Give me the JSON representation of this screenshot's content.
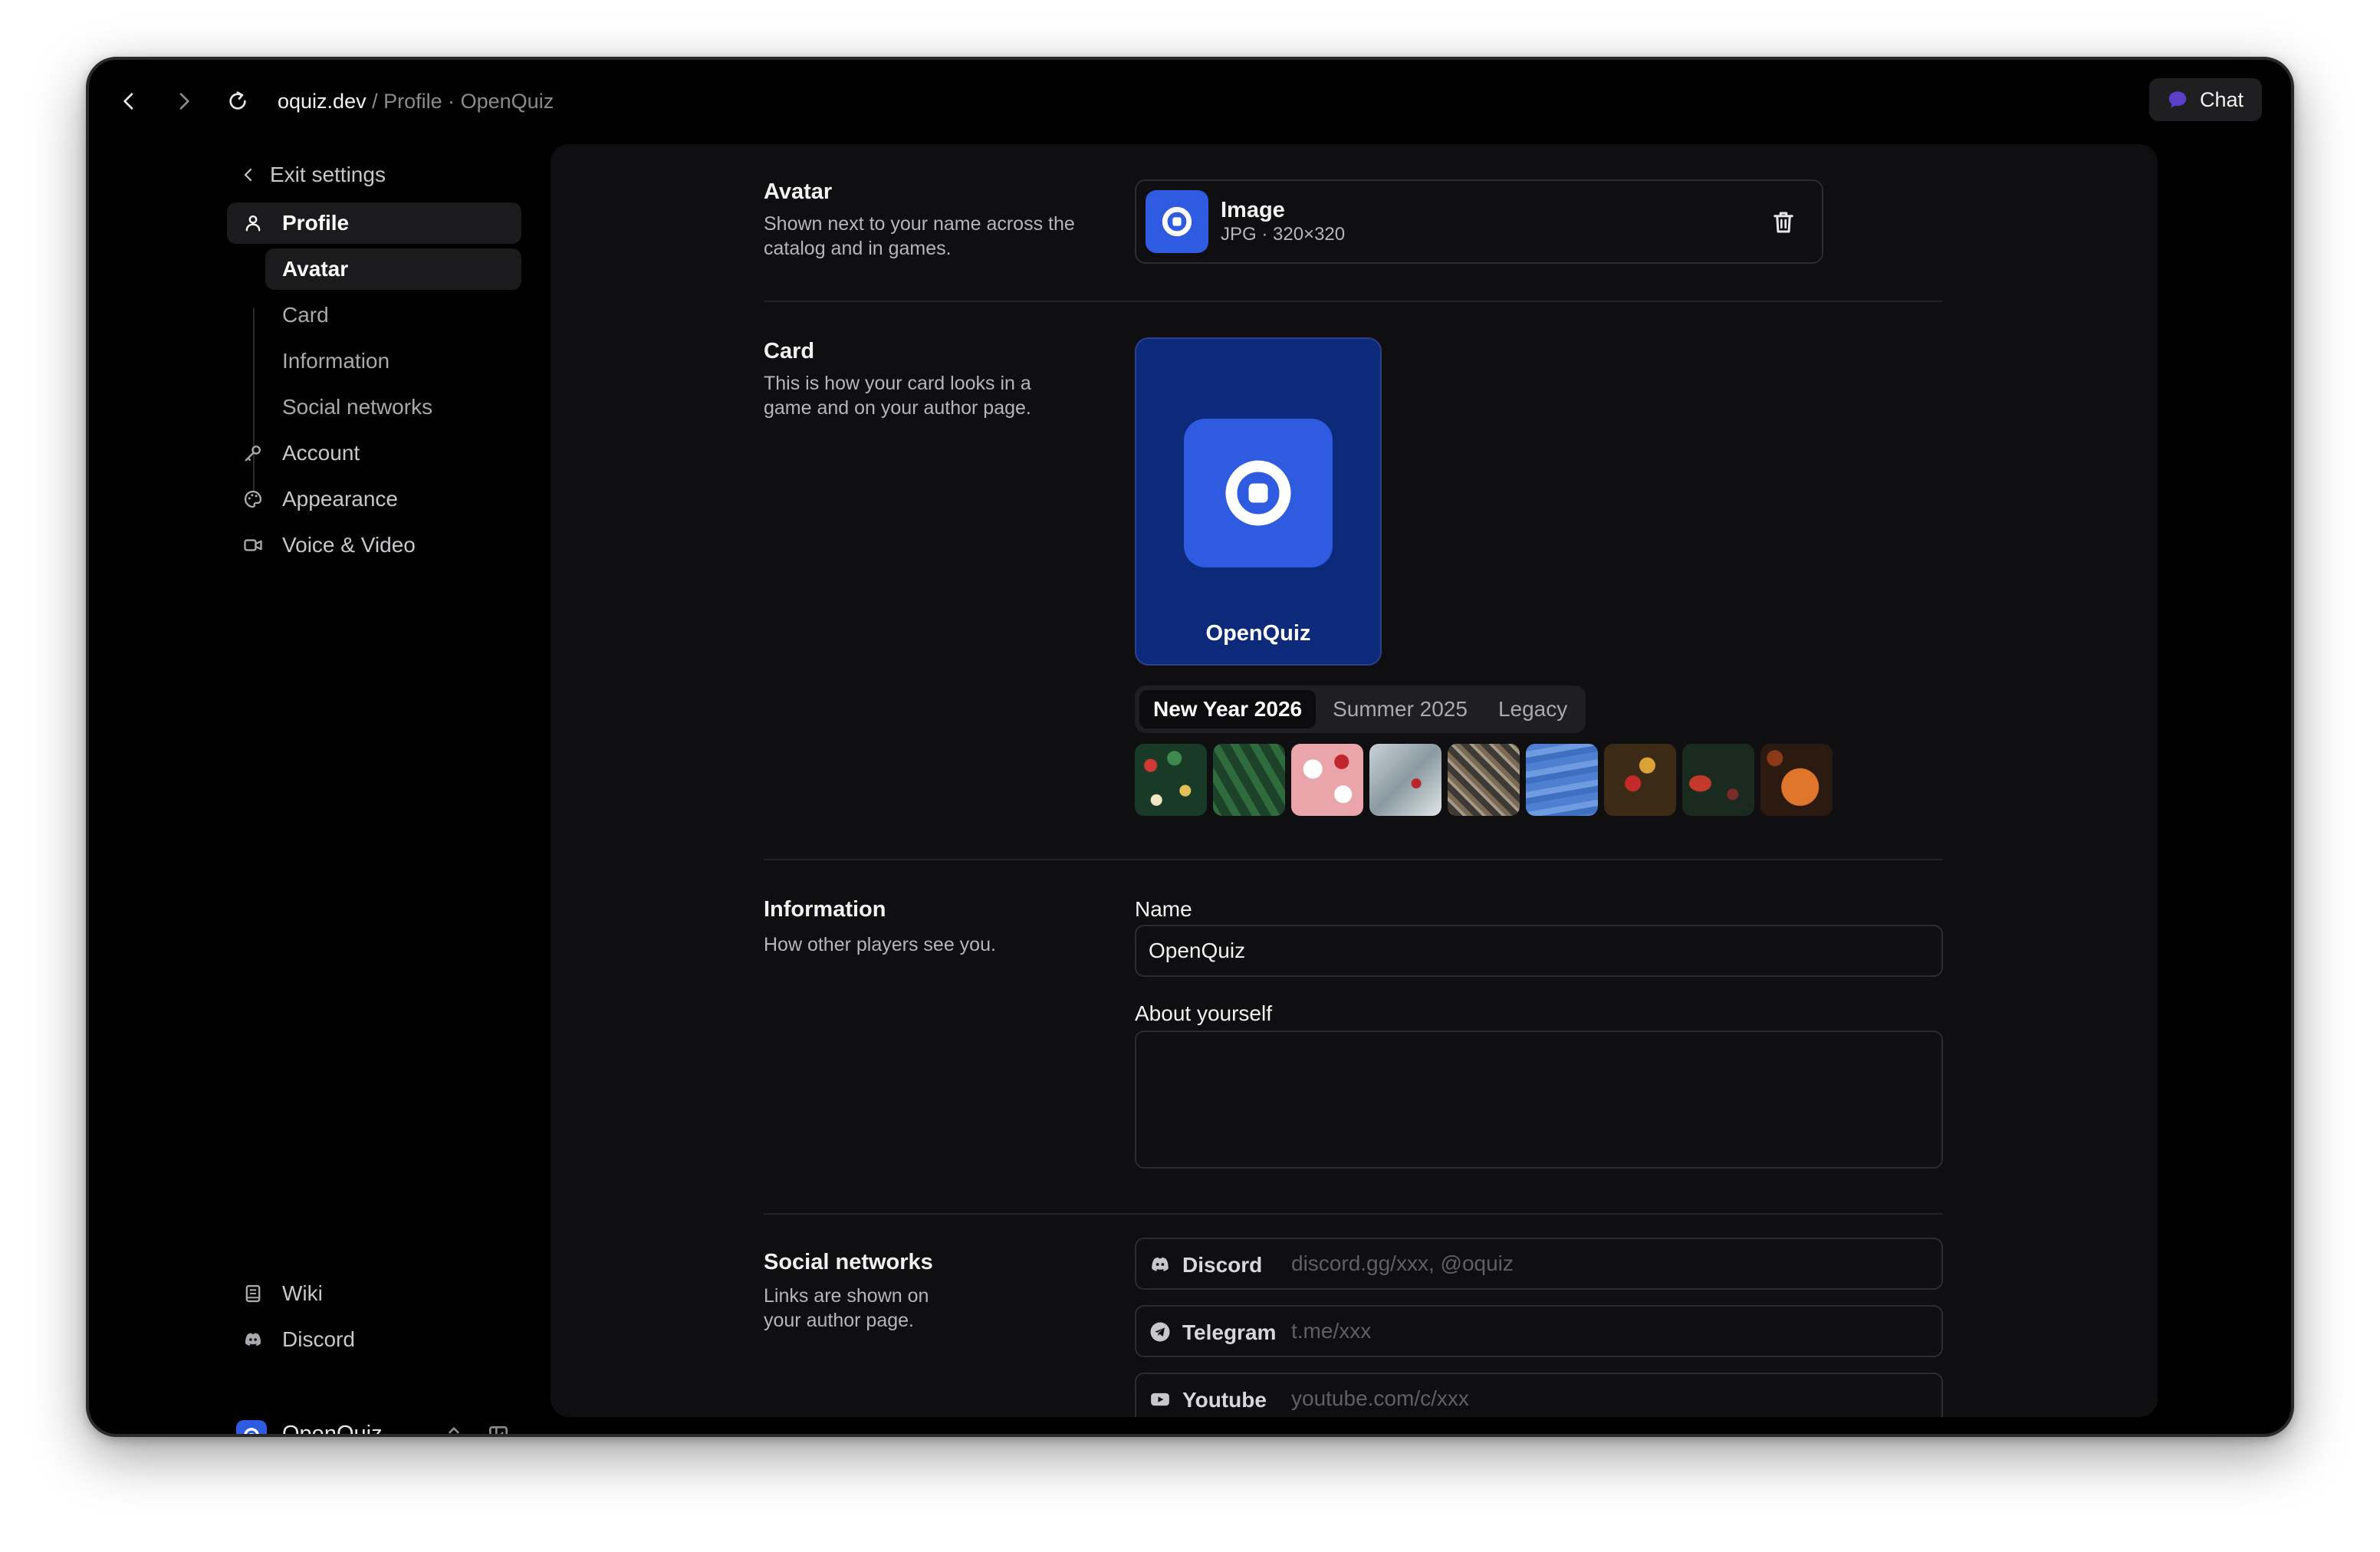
{
  "browser": {
    "url_domain": "oquiz.dev",
    "url_path": " / Profile · OpenQuiz",
    "chat_label": "Chat",
    "accent_chat": "#5b3fc9"
  },
  "sidebar": {
    "exit_label": "Exit settings",
    "profile_label": "Profile",
    "sub_items": [
      "Avatar",
      "Card",
      "Information",
      "Social networks"
    ],
    "account_label": "Account",
    "appearance_label": "Appearance",
    "voice_video_label": "Voice & Video",
    "wiki_label": "Wiki",
    "discord_label": "Discord",
    "user_name": "OpenQuiz"
  },
  "avatar_section": {
    "title": "Avatar",
    "description": "Shown next to your name across the catalog and in games.",
    "file_name": "Image",
    "file_meta": "JPG · 320×320"
  },
  "card_section": {
    "title": "Card",
    "description": "This is how your card looks in a game and on your author page.",
    "card_name": "OpenQuiz",
    "theme_tabs": [
      "New Year 2026",
      "Summer 2025",
      "Legacy"
    ],
    "active_theme": "New Year 2026",
    "swatch_count": 9
  },
  "information_section": {
    "title": "Information",
    "description": "How other players see you.",
    "name_label": "Name",
    "name_value": "OpenQuiz",
    "about_label": "About yourself",
    "about_value": ""
  },
  "social_section": {
    "title": "Social networks",
    "description": "Links are shown on your author page.",
    "networks": [
      {
        "label": "Discord",
        "placeholder": "discord.gg/xxx, @oquiz",
        "value": ""
      },
      {
        "label": "Telegram",
        "placeholder": "t.me/xxx",
        "value": ""
      },
      {
        "label": "Youtube",
        "placeholder": "youtube.com/c/xxx",
        "value": ""
      }
    ]
  },
  "colors": {
    "brand_blue": "#2f5be0",
    "card_background": "#0d2a7a",
    "window_background": "#000000",
    "panel_background": "#0f0f11"
  }
}
